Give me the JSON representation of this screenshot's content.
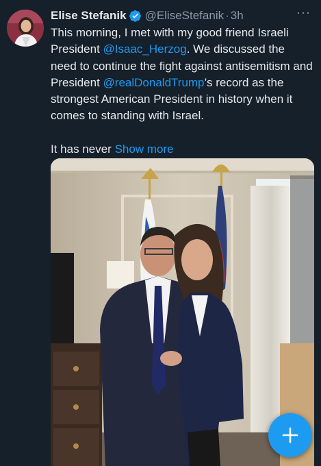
{
  "author": {
    "name": "Elise Stefanik",
    "handle": "@EliseStefanik",
    "separator": "·",
    "time": "3h"
  },
  "icons": {
    "verified": "verified-badge-icon",
    "more": "more-options-icon",
    "compose": "plus-icon"
  },
  "tweet": {
    "text_1": "This morning, I met with my good friend Israeli President ",
    "mention_1": "@Isaac_Herzog",
    "text_2": ". We discussed the need to continue the fight against antisemitism and President ",
    "mention_2": "@realDonaldTrump",
    "text_3": "’s record as the strongest American President in history when it comes to standing with Israel.",
    "text_4": "It has never ",
    "show_more": "Show more"
  },
  "more_glyph": "···",
  "colors": {
    "background": "#15202b",
    "link": "#1d9bf0",
    "muted": "#8b98a5"
  }
}
